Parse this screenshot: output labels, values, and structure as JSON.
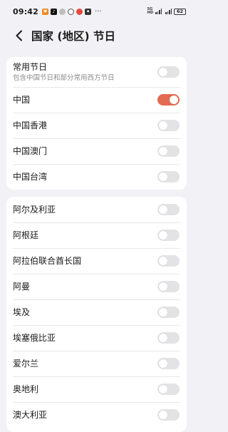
{
  "status_bar": {
    "time": "09:42",
    "network_label": "5G",
    "network_label_2": "HD",
    "battery": "62"
  },
  "header": {
    "title": "国家 (地区) 节日"
  },
  "groups": [
    {
      "items": [
        {
          "label": "常用节日",
          "desc": "包含中国节日和部分常用西方节日",
          "enabled": false
        },
        {
          "label": "中国",
          "enabled": true
        },
        {
          "label": "中国香港",
          "enabled": false
        },
        {
          "label": "中国澳门",
          "enabled": false
        },
        {
          "label": "中国台湾",
          "enabled": false
        }
      ]
    },
    {
      "items": [
        {
          "label": "阿尔及利亚",
          "enabled": false
        },
        {
          "label": "阿根廷",
          "enabled": false
        },
        {
          "label": "阿拉伯联合酋长国",
          "enabled": false
        },
        {
          "label": "阿曼",
          "enabled": false
        },
        {
          "label": "埃及",
          "enabled": false
        },
        {
          "label": "埃塞俄比亚",
          "enabled": false
        },
        {
          "label": "爱尔兰",
          "enabled": false
        },
        {
          "label": "奥地利",
          "enabled": false
        },
        {
          "label": "澳大利亚",
          "enabled": false
        }
      ]
    }
  ],
  "colors": {
    "toggle_on": "#e26b52",
    "toggle_off": "#e3e3e6",
    "background": "#f2f2f6"
  }
}
